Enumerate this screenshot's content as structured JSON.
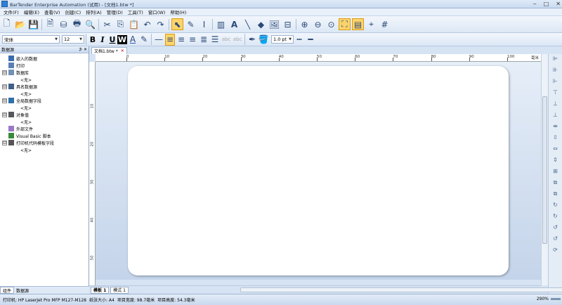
{
  "window": {
    "title": "BarTender Enterprise Automation (试用) - [文档1.btw *]"
  },
  "menu": [
    "文件(F)",
    "编辑(E)",
    "查看(V)",
    "创建(C)",
    "排列(A)",
    "管理(D)",
    "工具(T)",
    "窗口(W)",
    "帮助(H)"
  ],
  "format_bar": {
    "font_name": "宋体",
    "font_size": "12",
    "bold": "B",
    "italic": "I",
    "underline": "U",
    "word": "W",
    "line_width": "1.0 pt"
  },
  "panel": {
    "title": "数据源",
    "pin": "⊅ ✕",
    "nodes": [
      {
        "label": "嵌入的数据",
        "level": 0,
        "exp": "",
        "icon": "#3a6bb0"
      },
      {
        "label": "打印",
        "level": 0,
        "exp": "",
        "icon": "#5a7fb5"
      },
      {
        "label": "数据库",
        "level": 0,
        "exp": "⊟",
        "icon": "#7090b8"
      },
      {
        "label": "<无>",
        "level": 2,
        "exp": "",
        "icon": ""
      },
      {
        "label": "具名数据源",
        "level": 0,
        "exp": "⊟",
        "icon": "#40608a"
      },
      {
        "label": "<无>",
        "level": 2,
        "exp": "",
        "icon": ""
      },
      {
        "label": "全局数据字段",
        "level": 0,
        "exp": "⊟",
        "icon": "#2f6fa8"
      },
      {
        "label": "<无>",
        "level": 2,
        "exp": "",
        "icon": ""
      },
      {
        "label": "对象值",
        "level": 0,
        "exp": "⊟",
        "icon": "#55585e"
      },
      {
        "label": "<无>",
        "level": 2,
        "exp": "",
        "icon": ""
      },
      {
        "label": "外部文件",
        "level": 0,
        "exp": "",
        "icon": "#9a77c8"
      },
      {
        "label": "Visual Basic 脚本",
        "level": 0,
        "exp": "",
        "icon": "#3a8a3a"
      },
      {
        "label": "打印机代码模板字段",
        "level": 0,
        "exp": "⊟",
        "icon": "#555"
      },
      {
        "label": "<无>",
        "level": 2,
        "exp": "",
        "icon": ""
      }
    ],
    "tabs": [
      "组件",
      "数据源"
    ]
  },
  "document_tab": {
    "label": "文档1.btw *",
    "close": "✕"
  },
  "ruler": {
    "h_marks": [
      "0",
      "10",
      "20",
      "30",
      "40",
      "50",
      "60",
      "70",
      "80",
      "90",
      "100"
    ],
    "h_unit": "毫米",
    "v_marks": [
      "10",
      "20",
      "30",
      "40",
      "50"
    ]
  },
  "sheet_tabs": [
    "模板 1",
    "模式 1"
  ],
  "status": {
    "printer": "打印机: HP LaserJet Pro MFP M127-M128",
    "paper": "纸张大小: A4",
    "width": "项目宽度: 98.7毫米",
    "height": "项目高度: 54.3毫米",
    "zoom": "290%"
  }
}
